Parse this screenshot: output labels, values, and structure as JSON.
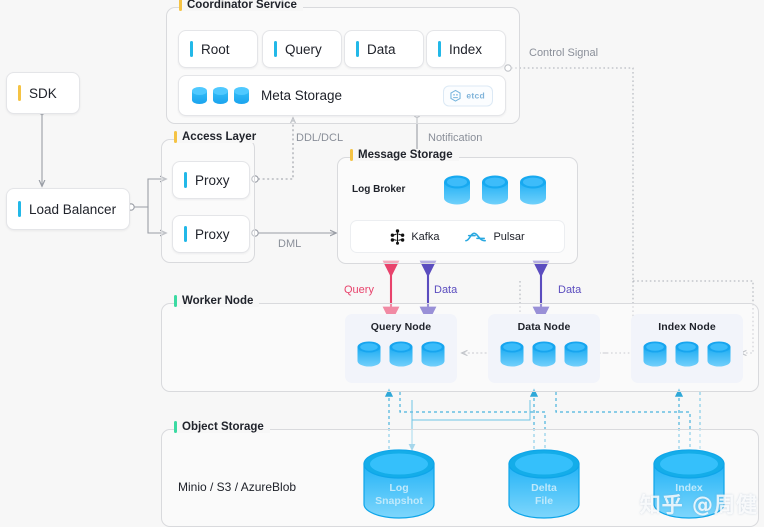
{
  "theme": {
    "bg": "#f7f7f7",
    "accent_yellow": "#f5c344",
    "accent_cyan": "#22b8e8",
    "accent_green": "#3bdaa2",
    "query_color": "#e8436c",
    "data_color": "#5b4dbf",
    "storage_cyan": "#29b6f6",
    "wire_gray": "#9a9ea6"
  },
  "groups": {
    "coordinator": {
      "title": "Coordinator Service",
      "accent": "#f5c344"
    },
    "access": {
      "title": "Access Layer",
      "accent": "#f5c344"
    },
    "message": {
      "title": "Message Storage",
      "accent": "#f5c344"
    },
    "worker": {
      "title": "Worker Node",
      "accent": "#3bdaa2"
    },
    "object": {
      "title": "Object Storage",
      "accent": "#3bdaa2"
    }
  },
  "coordinator": {
    "coords": [
      {
        "label": "Root",
        "accent": "#22b8e8"
      },
      {
        "label": "Query",
        "accent": "#22b8e8"
      },
      {
        "label": "Data",
        "accent": "#22b8e8"
      },
      {
        "label": "Index",
        "accent": "#22b8e8"
      }
    ],
    "meta_storage": {
      "label": "Meta Storage",
      "cylinders": 3,
      "badge": "etcd"
    }
  },
  "client": {
    "sdk": {
      "label": "SDK",
      "accent": "#f5c344"
    },
    "load_balancer": {
      "label": "Load Balancer",
      "accent": "#22b8e8"
    }
  },
  "access": {
    "proxies": [
      {
        "label": "Proxy",
        "accent": "#22b8e8"
      },
      {
        "label": "Proxy",
        "accent": "#22b8e8"
      }
    ]
  },
  "message": {
    "log_broker_label": "Log Broker",
    "broker_cylinders": 3,
    "brokers": [
      {
        "label": "Kafka",
        "icon": "kafka-icon"
      },
      {
        "label": "Pulsar",
        "icon": "pulsar-icon"
      }
    ]
  },
  "worker": {
    "nodes": [
      {
        "label": "Query Node",
        "cylinders": 3
      },
      {
        "label": "Data Node",
        "cylinders": 3
      },
      {
        "label": "Index Node",
        "cylinders": 3
      }
    ]
  },
  "object": {
    "providers_label": "Minio / S3 / AzureBlob",
    "stores": [
      {
        "label": "Log\nSnapshot",
        "line1": "Log",
        "line2": "Snapshot"
      },
      {
        "label": "Delta\nFile",
        "line1": "Delta",
        "line2": "File"
      },
      {
        "label": "Index",
        "line1": "Index",
        "line2": ""
      }
    ]
  },
  "edges": {
    "control_signal": "Control Signal",
    "ddl_dcl": "DDL/DCL",
    "notification": "Notification",
    "dml": "DML",
    "query": "Query",
    "data_left": "Data",
    "data_right": "Data"
  },
  "watermark": {
    "text": "知乎 @周健"
  }
}
